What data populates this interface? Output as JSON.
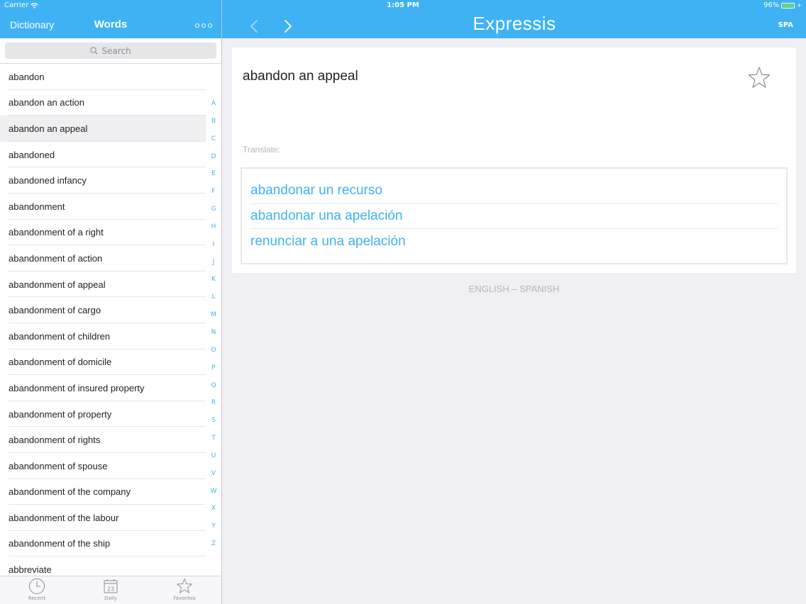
{
  "status": {
    "carrier": "Carrier",
    "time": "1:05 PM",
    "battery": "96%"
  },
  "left_nav": {
    "dictionary_label": "Dictionary",
    "words_label": "Words"
  },
  "right_nav": {
    "title": "Expressis",
    "lang_code": "SPA"
  },
  "search": {
    "placeholder": "Search"
  },
  "words": [
    "abandon",
    "abandon an action",
    "abandon an appeal",
    "abandoned",
    "abandoned infancy",
    "abandonment",
    "abandonment of a right",
    "abandonment of action",
    "abandonment of appeal",
    "abandonment of cargo",
    "abandonment of children",
    "abandonment of domicile",
    "abandonment of insured property",
    "abandonment of property",
    "abandonment of rights",
    "abandonment of spouse",
    "abandonment of the company",
    "abandonment of the labour",
    "abandonment of the ship",
    "abbreviate"
  ],
  "selected_word_index": 2,
  "alphabet": [
    "A",
    "B",
    "C",
    "D",
    "E",
    "F",
    "G",
    "H",
    "I",
    "J",
    "K",
    "L",
    "M",
    "N",
    "O",
    "P",
    "Q",
    "R",
    "S",
    "T",
    "U",
    "V",
    "W",
    "X",
    "Y",
    "Z"
  ],
  "tabs": [
    {
      "label": "Recent",
      "icon": "clock-icon"
    },
    {
      "label": "Daily",
      "icon": "calendar-icon",
      "day": "23"
    },
    {
      "label": "Favorites",
      "icon": "star-icon"
    }
  ],
  "detail": {
    "phrase": "abandon an appeal",
    "translate_label": "Translate:",
    "translations": [
      "abandonar un recurso",
      "abandonar una apelación",
      "renunciar a una apelación"
    ],
    "language_pair": "ENGLISH – SPANISH"
  },
  "colors": {
    "accent": "#3fb2f4",
    "background": "#efeff4"
  }
}
